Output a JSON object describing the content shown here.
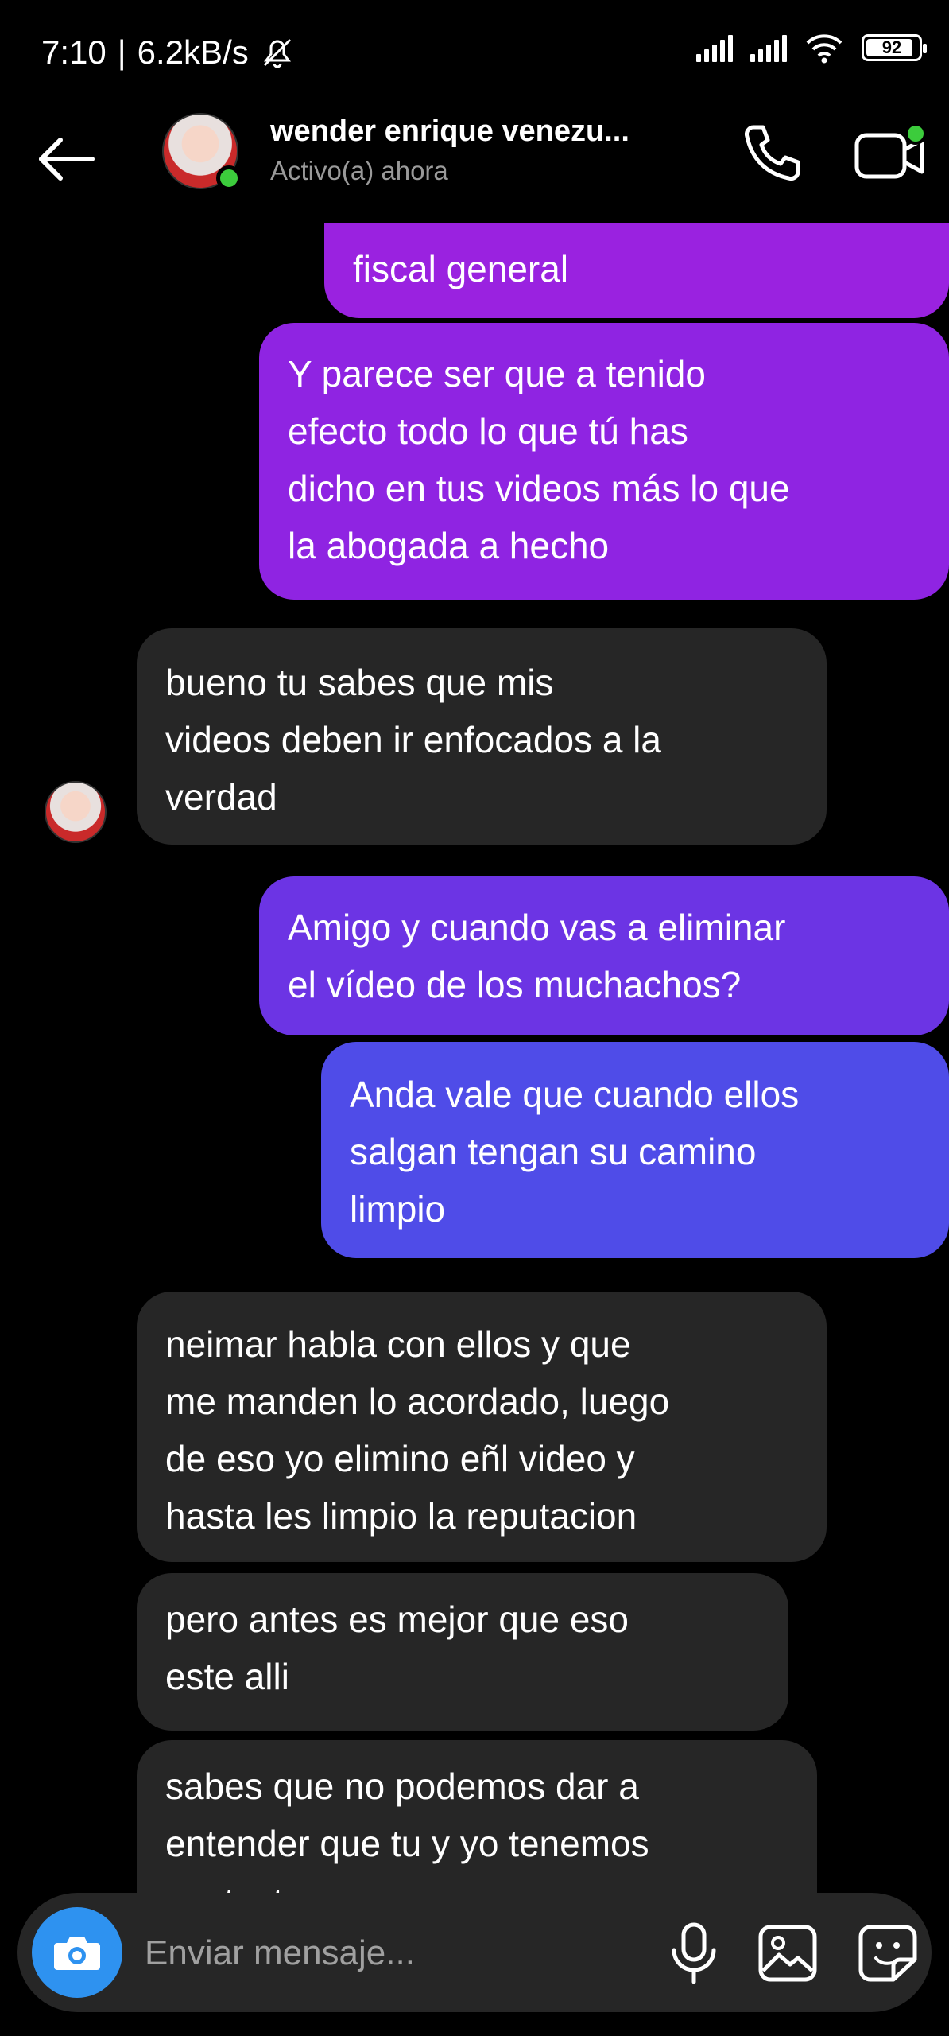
{
  "status_bar": {
    "time": "7:10",
    "separator": "|",
    "speed": "6.2kB/s",
    "battery": "92"
  },
  "header": {
    "contact_name": "wender enrique venezu...",
    "contact_status": "Activo(a) ahora"
  },
  "messages": [
    {
      "id": "m0",
      "from": "me",
      "text": "fiscal general"
    },
    {
      "id": "m1",
      "from": "me",
      "text": "Y parece ser que a tenido\nefecto todo lo que tú has\ndicho en tus videos más lo que\nla abogada a hecho"
    },
    {
      "id": "m2",
      "from": "them",
      "text": "bueno tu sabes que mis\nvideos deben ir enfocados a la\nverdad"
    },
    {
      "id": "m3",
      "from": "me",
      "text": "Amigo y cuando vas a eliminar\nel vídeo de los muchachos?"
    },
    {
      "id": "m4",
      "from": "me",
      "text": "Anda vale que cuando ellos\nsalgan tengan su camino\nlimpio"
    },
    {
      "id": "m5",
      "from": "them",
      "text": "neimar habla con ellos y que\nme manden lo acordado, luego\nde eso yo elimino eñl video y\nhasta les limpio la reputacion"
    },
    {
      "id": "m6",
      "from": "them",
      "text": "pero antes es mejor que eso\neste alli"
    },
    {
      "id": "m7",
      "from": "them",
      "text": "sabes que no podemos dar a\nentender que tu y yo tenemos\ncontacto"
    }
  ],
  "composer": {
    "placeholder": "Enviar mensaje..."
  },
  "icons": {
    "back": "arrow-left-icon",
    "call": "phone-icon",
    "video": "video-camera-icon",
    "camera": "camera-icon",
    "mic": "microphone-icon",
    "gallery": "image-gallery-icon",
    "sticker": "sticker-icon"
  },
  "colors": {
    "background": "#000000",
    "received_bubble": "#262626",
    "sent_gradient_top": "#a020e0",
    "sent_gradient_bottom": "#4a52e8",
    "online": "#3ccc3c",
    "camera_button": "#2e92f0"
  }
}
